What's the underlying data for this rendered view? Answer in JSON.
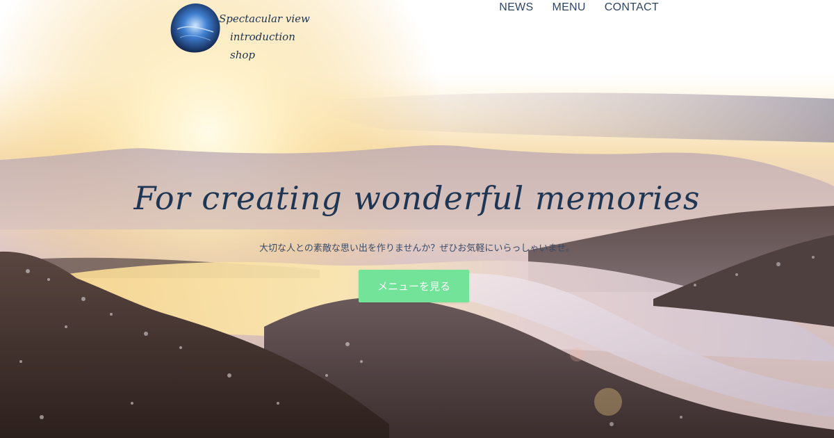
{
  "header": {
    "logo": {
      "line1": "Spectacular view",
      "line2": "introduction shop"
    },
    "nav": [
      {
        "label": "NEWS"
      },
      {
        "label": "MENU"
      },
      {
        "label": "CONTACT"
      }
    ]
  },
  "hero": {
    "title": "For creating wonderful memories",
    "subtitle": "大切な人との素敵な思い出を作りませんか？ぜひお気軽にいらっしゃいませ。",
    "cta_label": "メニューを見る"
  },
  "colors": {
    "accent": "#74e39a",
    "text": "#1e3654"
  }
}
